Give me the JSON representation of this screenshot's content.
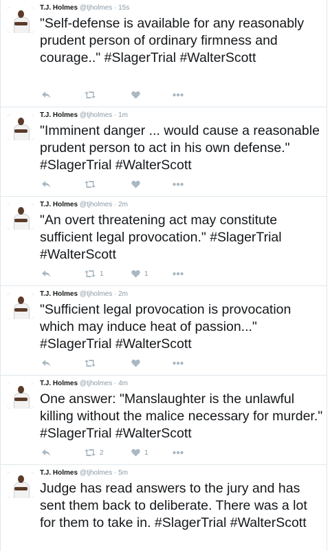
{
  "author": {
    "name": "T.J. Holmes",
    "handle": "@tjholmes"
  },
  "separator": "·",
  "tweets": [
    {
      "time": "15s",
      "text": "\"Self-defense is available for any reasonably prudent person of ordinary firmness and courage..\" #SlagerTrial #WalterScott",
      "retweets": "",
      "likes": ""
    },
    {
      "time": "1m",
      "text": "\"Imminent danger ... would cause a reasonable prudent person to act in his own defense.\" #SlagerTrial #WalterScott",
      "retweets": "",
      "likes": ""
    },
    {
      "time": "2m",
      "text": "\"An overt threatening act may constitute sufficient legal provocation.\" #SlagerTrial #WalterScott",
      "retweets": "1",
      "likes": "1"
    },
    {
      "time": "2m",
      "text": "\"Sufficient legal provocation is provocation which may induce heat of passion...\" #SlagerTrial #WalterScott",
      "retweets": "",
      "likes": ""
    },
    {
      "time": "4m",
      "text": "One answer: \"Manslaughter is the unlawful killing without the malice necessary for murder.\" #SlagerTrial #WalterScott",
      "retweets": "2",
      "likes": "1"
    },
    {
      "time": "5m",
      "text": "Judge has read answers to the jury and has sent them back to deliberate. There was a lot for them to take in. #SlagerTrial #WalterScott",
      "retweets": "",
      "likes": ""
    }
  ],
  "icons": {
    "reply": "reply-icon",
    "retweet": "retweet-icon",
    "like": "heart-icon",
    "more": "more-icon"
  },
  "colors": {
    "text": "#14171a",
    "meta": "#8899a6",
    "icon": "#aab8c2",
    "border": "#e1e8ed"
  }
}
